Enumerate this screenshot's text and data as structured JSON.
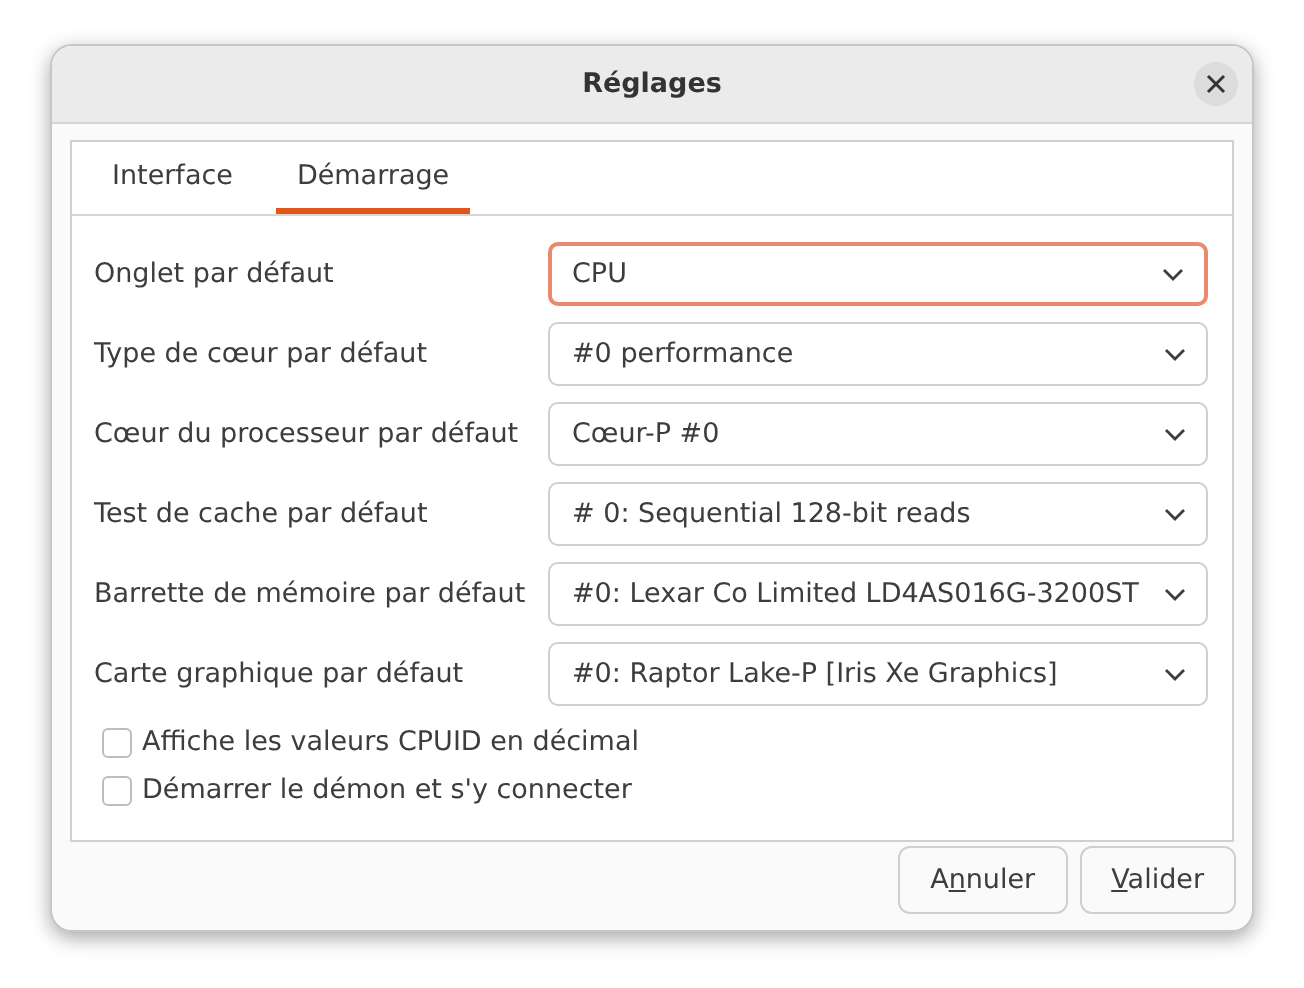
{
  "window": {
    "title": "Réglages"
  },
  "tabs": [
    {
      "label": "Interface",
      "selected": false
    },
    {
      "label": "Démarrage",
      "selected": true
    }
  ],
  "settings": [
    {
      "label": "Onglet par défaut",
      "value": "CPU",
      "focused": true
    },
    {
      "label": "Type de cœur par défaut",
      "value": "#0 performance",
      "focused": false
    },
    {
      "label": "Cœur du processeur par défaut",
      "value": "Cœur-P #0",
      "focused": false
    },
    {
      "label": "Test de cache par défaut",
      "value": "# 0: Sequential 128-bit reads",
      "focused": false
    },
    {
      "label": "Barrette de mémoire par défaut",
      "value": "#0: Lexar Co Limited LD4AS016G-3200ST",
      "focused": false
    },
    {
      "label": "Carte graphique par défaut",
      "value": "#0: Raptor Lake-P [Iris Xe Graphics]",
      "focused": false
    }
  ],
  "checkboxes": [
    {
      "label": "Affiche les valeurs CPUID en décimal",
      "checked": false
    },
    {
      "label": "Démarrer le démon et s'y connecter",
      "checked": false
    }
  ],
  "buttons": [
    {
      "before": "A",
      "mnemonic": "n",
      "after": "nuler"
    },
    {
      "mnemonic": "V",
      "after": "alider"
    }
  ]
}
